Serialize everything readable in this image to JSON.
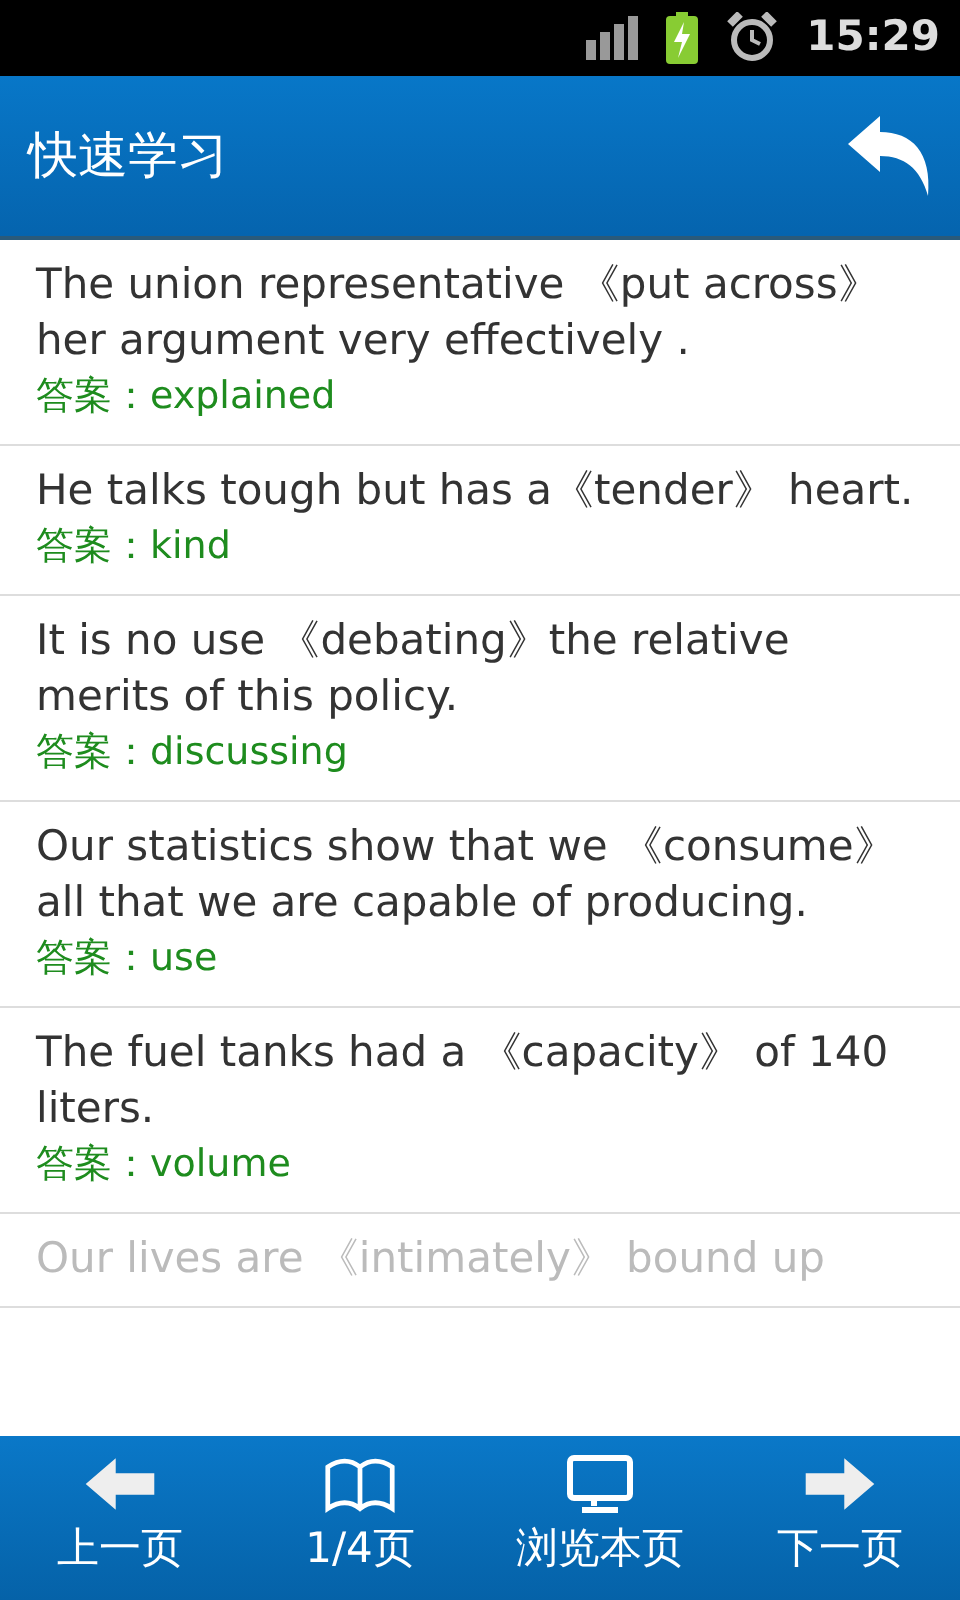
{
  "status_bar": {
    "time": "15:29"
  },
  "header": {
    "title": "快速学习"
  },
  "questions": [
    {
      "sentence": "The union representative 《put across》 her argument very effectively .",
      "answer": "答案：explained"
    },
    {
      "sentence": "He talks tough but has a《tender》 heart.",
      "answer": "答案：kind"
    },
    {
      "sentence": "It is no use 《debating》the relative merits of this policy.",
      "answer": "答案：discussing"
    },
    {
      "sentence": "Our statistics show that we 《consume》 all that we are capable of producing.",
      "answer": "答案：use"
    },
    {
      "sentence": "The fuel tanks had a 《capacity》 of 140 liters.",
      "answer": "答案：volume"
    },
    {
      "sentence": "Our lives are 《intimately》 bound up"
    }
  ],
  "bottom_bar": [
    {
      "kind": "prev",
      "label": "上一页"
    },
    {
      "kind": "book",
      "label": "1/4页"
    },
    {
      "kind": "monitor",
      "label": "浏览本页"
    },
    {
      "kind": "next",
      "label": "下一页"
    }
  ]
}
